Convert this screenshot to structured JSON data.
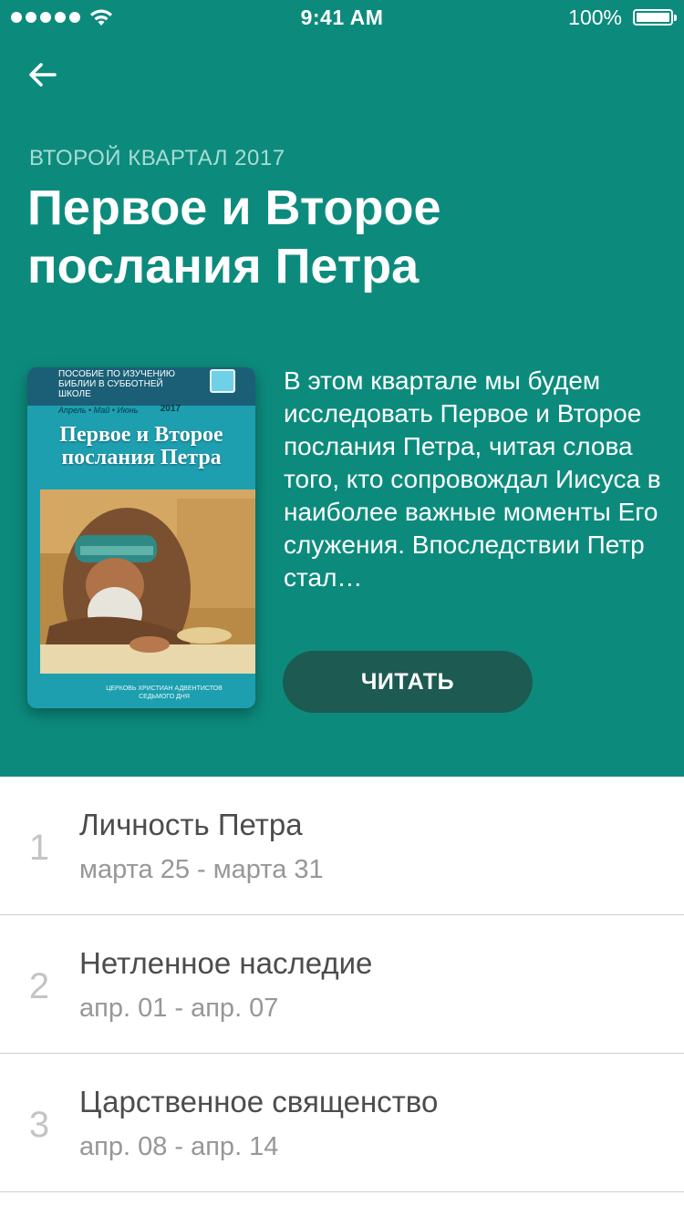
{
  "status_bar": {
    "time": "9:41 AM",
    "battery": "100%"
  },
  "header": {
    "quarter_label": "ВТОРОЙ КВАРТАЛ 2017",
    "title": "Первое и Второе послания Петра",
    "description": "В этом квартале мы будем исследовать Первое и Второе послания Петра, читая слова того, кто сопровождал Иисуса в наиболее важные моменты Его служения. Впоследствии Петр стал…",
    "read_button_label": "ЧИТАТЬ",
    "background_color": "#0c8b7d",
    "button_color": "#1d5a52"
  },
  "cover": {
    "series": "Пособие по изучению Библии в субботней школе",
    "months": "Апрель • Май • Июнь",
    "year": "2017",
    "title": "Первое и Второе послания Петра",
    "publisher": "Церковь христиан адвентистов седьмого дня"
  },
  "lessons": [
    {
      "number": "1",
      "title": "Личность Петра",
      "dates": "марта 25 - марта 31"
    },
    {
      "number": "2",
      "title": "Нетленное наследие",
      "dates": "апр. 01 - апр. 07"
    },
    {
      "number": "3",
      "title": "Царственное священство",
      "dates": "апр. 08 - апр. 14"
    }
  ]
}
